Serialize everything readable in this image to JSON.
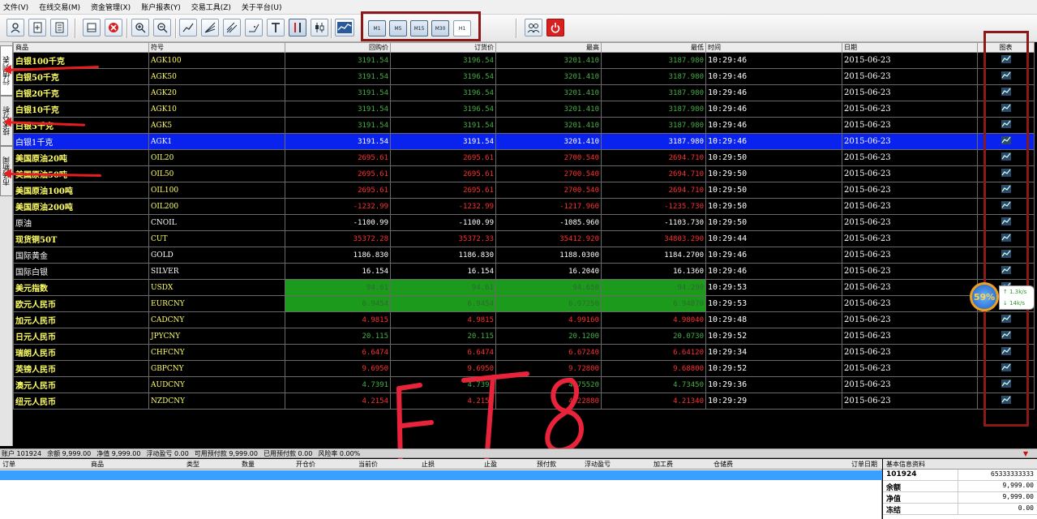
{
  "menu": [
    "文件(V)",
    "在线交易(M)",
    "资金管理(X)",
    "账户报表(Y)",
    "交易工具(Z)",
    "关于平台(U)"
  ],
  "periods": [
    "M1",
    "M5",
    "M15",
    "M30",
    "H1"
  ],
  "side_tabs": [
    "行情列表",
    "技术分析",
    "市场新闻"
  ],
  "table": {
    "headers": [
      "商品",
      "符号",
      "回购价",
      "订货价",
      "最高",
      "最低",
      "时间",
      "日期",
      "图表"
    ],
    "rows": [
      {
        "name": "白银100千克",
        "symbol": "AGK100",
        "bid": "3191.54",
        "ask": "3196.54",
        "high": "3201.410",
        "low": "3187.980",
        "time": "10:29:46",
        "date": "2015-06-23"
      },
      {
        "name": "白银50千克",
        "symbol": "AGK50",
        "bid": "3191.54",
        "ask": "3196.54",
        "high": "3201.410",
        "low": "3187.980",
        "time": "10:29:46",
        "date": "2015-06-23"
      },
      {
        "name": "白银20千克",
        "symbol": "AGK20",
        "bid": "3191.54",
        "ask": "3196.54",
        "high": "3201.410",
        "low": "3187.980",
        "time": "10:29:46",
        "date": "2015-06-23"
      },
      {
        "name": "白银10千克",
        "symbol": "AGK10",
        "bid": "3191.54",
        "ask": "3196.54",
        "high": "3201.410",
        "low": "3187.980",
        "time": "10:29:46",
        "date": "2015-06-23"
      },
      {
        "name": "白银5千克",
        "symbol": "AGK5",
        "bid": "3191.54",
        "ask": "3191.54",
        "high": "3201.410",
        "low": "3187.980",
        "time": "10:29:46",
        "date": "2015-06-23"
      },
      {
        "name": "白银1千克",
        "symbol": "AGK1",
        "bid": "3191.54",
        "ask": "3191.54",
        "high": "3201.410",
        "low": "3187.980",
        "time": "10:29:46",
        "date": "2015-06-23"
      },
      {
        "name": "美国原油20吨",
        "symbol": "OIL20",
        "bid": "2695.61",
        "ask": "2695.61",
        "high": "2700.540",
        "low": "2694.710",
        "time": "10:29:50",
        "date": "2015-06-23"
      },
      {
        "name": "美国原油50吨",
        "symbol": "OIL50",
        "bid": "2695.61",
        "ask": "2695.61",
        "high": "2700.540",
        "low": "2694.710",
        "time": "10:29:50",
        "date": "2015-06-23"
      },
      {
        "name": "美国原油100吨",
        "symbol": "OIL100",
        "bid": "2695.61",
        "ask": "2695.61",
        "high": "2700.540",
        "low": "2694.710",
        "time": "10:29:50",
        "date": "2015-06-23"
      },
      {
        "name": "美国原油200吨",
        "symbol": "OIL200",
        "bid": "-1232.99",
        "ask": "-1232.99",
        "high": "-1217.960",
        "low": "-1235.730",
        "time": "10:29:50",
        "date": "2015-06-23"
      },
      {
        "name": "原油",
        "symbol": "CNOIL",
        "bid": "-1100.99",
        "ask": "-1100.99",
        "high": "-1085.960",
        "low": "-1103.730",
        "time": "10:29:50",
        "date": "2015-06-23"
      },
      {
        "name": "现货铜50T",
        "symbol": "CUT",
        "bid": "35372.28",
        "ask": "35372.33",
        "high": "35412.920",
        "low": "34803.290",
        "time": "10:29:44",
        "date": "2015-06-23"
      },
      {
        "name": "国际黄金",
        "symbol": "GOLD",
        "bid": "1186.830",
        "ask": "1186.830",
        "high": "1188.0300",
        "low": "1184.2700",
        "time": "10:29:46",
        "date": "2015-06-23"
      },
      {
        "name": "国际白银",
        "symbol": "SILVER",
        "bid": "16.154",
        "ask": "16.154",
        "high": "16.2040",
        "low": "16.1360",
        "time": "10:29:46",
        "date": "2015-06-23"
      },
      {
        "name": "美元指数",
        "symbol": "USDX",
        "bid": "94.61",
        "ask": "94.61",
        "high": "94.650",
        "low": "94.290",
        "time": "10:29:53",
        "date": "2015-06-23"
      },
      {
        "name": "欧元人民币",
        "symbol": "EURCNY",
        "bid": "6.9454",
        "ask": "6.9454",
        "high": "6.97250",
        "low": "6.94070",
        "time": "10:29:53",
        "date": "2015-06-23"
      },
      {
        "name": "加元人民币",
        "symbol": "CADCNY",
        "bid": "4.9815",
        "ask": "4.9815",
        "high": "4.99160",
        "low": "4.98040",
        "time": "10:29:48",
        "date": "2015-06-23"
      },
      {
        "name": "日元人民币",
        "symbol": "JPYCNY",
        "bid": "20.115",
        "ask": "20.115",
        "high": "20.1200",
        "low": "20.0730",
        "time": "10:29:52",
        "date": "2015-06-23"
      },
      {
        "name": "瑞朗人民币",
        "symbol": "CHFCNY",
        "bid": "6.6474",
        "ask": "6.6474",
        "high": "6.67240",
        "low": "6.64120",
        "time": "10:29:34",
        "date": "2015-06-23"
      },
      {
        "name": "英镑人民币",
        "symbol": "GBPCNY",
        "bid": "9.6950",
        "ask": "9.6950",
        "high": "9.72800",
        "low": "9.68800",
        "time": "10:29:52",
        "date": "2015-06-23"
      },
      {
        "name": "澳元人民币",
        "symbol": "AUDCNY",
        "bid": "4.7391",
        "ask": "4.7391",
        "high": "4.75520",
        "low": "4.73450",
        "time": "10:29:36",
        "date": "2015-06-23"
      },
      {
        "name": "纽元人民币",
        "symbol": "NZDCNY",
        "bid": "4.2154",
        "ask": "4.2154",
        "high": "4.22880",
        "low": "4.21340",
        "time": "10:29:29",
        "date": "2015-06-23"
      }
    ]
  },
  "row_colors": [
    "green",
    "green",
    "green",
    "green",
    "green",
    "white",
    "red",
    "red",
    "red",
    "red",
    "white",
    "red",
    "white",
    "white",
    "green",
    "red",
    "red",
    "green",
    "red",
    "red",
    "green",
    "red"
  ],
  "selected_row": 5,
  "highlight_rows": [
    14,
    15
  ],
  "overlay_text": "ET8",
  "badge": {
    "value": "59%",
    "up": "1.3k/s",
    "down": "14k/s"
  },
  "status": [
    "账户 101924",
    "余额 9,999.00",
    "净值 9,999.00",
    "浮动盈亏 0.00",
    "可用预付款 9,999.00",
    "已用预付款 0.00",
    "风险率 0.00%"
  ],
  "orders": {
    "headers": [
      "订单",
      "商品",
      "类型",
      "数量",
      "开仓价",
      "当前价",
      "止损",
      "止盈",
      "预付款",
      "浮动盈亏",
      "加工费",
      "仓储费",
      "订单日期"
    ]
  },
  "info": {
    "title": "基本信息资料",
    "rows": [
      {
        "k": "101924",
        "v": "65333333333"
      },
      {
        "k": "余额",
        "v": "9,999.00"
      },
      {
        "k": "净值",
        "v": "9,999.00"
      },
      {
        "k": "冻结",
        "v": "0.00"
      }
    ]
  },
  "colors": {
    "green": "#44b044",
    "red": "#ff3030",
    "white": "#ffffff",
    "selected": "#0a22ee",
    "highlight": "#1c9a1c",
    "annotation": "#8a1a1a",
    "arrow": "#e81e1e",
    "handwriting": "#e8233a"
  }
}
